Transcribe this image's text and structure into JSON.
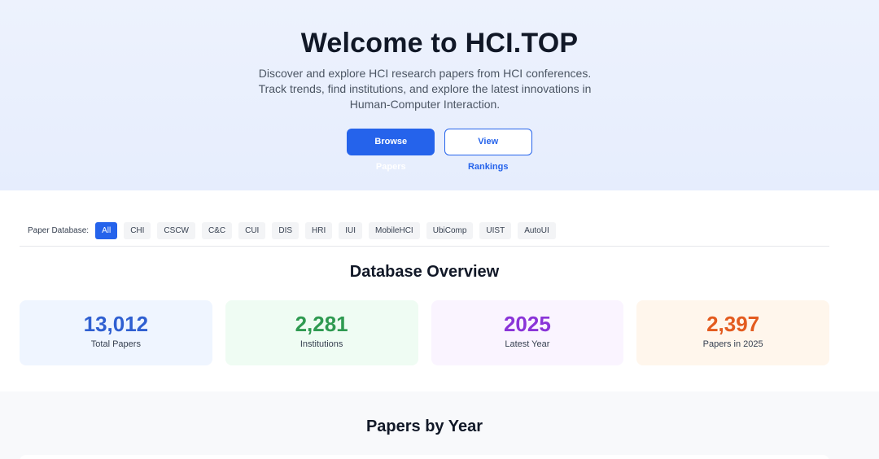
{
  "hero": {
    "title": "Welcome to HCI.TOP",
    "description": "Discover and explore HCI research papers from HCI conferences. Track trends, find institutions, and explore the latest innovations in Human-Computer Interaction.",
    "primary_button": "Browse Papers",
    "secondary_button": "View Rankings"
  },
  "filter": {
    "label": "Paper Database:",
    "options": [
      "All",
      "CHI",
      "CSCW",
      "C&C",
      "CUI",
      "DIS",
      "HRI",
      "IUI",
      "MobileHCI",
      "UbiComp",
      "UIST",
      "AutoUI"
    ],
    "selected": "All"
  },
  "overview": {
    "title": "Database Overview",
    "stats": [
      {
        "value": "13,012",
        "label": "Total Papers",
        "color": "#2f5fd1",
        "bg": "#eff5ff"
      },
      {
        "value": "2,281",
        "label": "Institutions",
        "color": "#2f9a51",
        "bg": "#effcf3"
      },
      {
        "value": "2025",
        "label": "Latest Year",
        "color": "#8a34d8",
        "bg": "#faf4ff"
      },
      {
        "value": "2,397",
        "label": "Papers in 2025",
        "color": "#e35b1f",
        "bg": "#fff6ec"
      }
    ]
  },
  "papers_by_year": {
    "title": "Papers by Year"
  },
  "colors": {
    "accent": "#2563eb"
  }
}
